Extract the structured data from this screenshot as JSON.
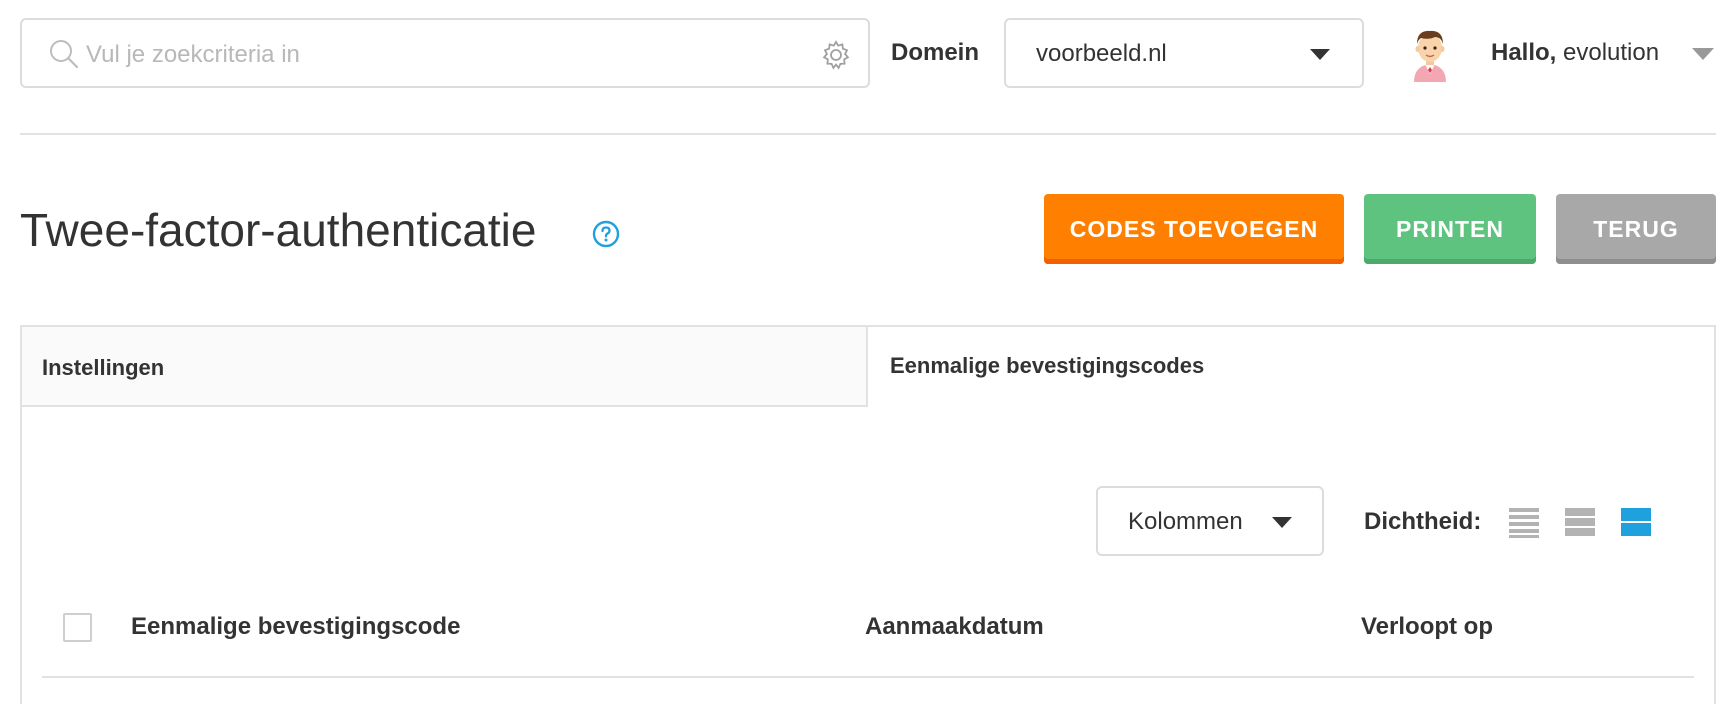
{
  "header": {
    "search": {
      "placeholder": "Vul je zoekcriteria in",
      "value": ""
    },
    "domain_label": "Domein",
    "domain_value": "voorbeeld.nl",
    "greeting_prefix": "Hallo,",
    "username": "evolution"
  },
  "page": {
    "title": "Twee-factor-authenticatie",
    "actions": {
      "add_codes": "CODES TOEVOEGEN",
      "print": "PRINTEN",
      "back": "TERUG"
    }
  },
  "tabs": [
    {
      "label": "Instellingen",
      "active": false
    },
    {
      "label": "Eenmalige bevestigingscodes",
      "active": true
    }
  ],
  "toolbar": {
    "columns_label": "Kolommen",
    "density_label": "Dichtheid:",
    "density_options": [
      "compact",
      "normal",
      "comfortable"
    ],
    "density_selected": "comfortable"
  },
  "table": {
    "columns": [
      "Eenmalige bevestigingscode",
      "Aanmaakdatum",
      "Verloopt op"
    ],
    "rows": []
  },
  "colors": {
    "orange": "#ff8000",
    "green": "#5ec37f",
    "grey": "#a8a8a8",
    "accent_blue": "#1ea1dc"
  },
  "icons": {
    "search": "search-icon",
    "settings": "gear-icon",
    "help": "help-icon",
    "dropdown": "caret-down-icon",
    "avatar": "user-avatar"
  }
}
